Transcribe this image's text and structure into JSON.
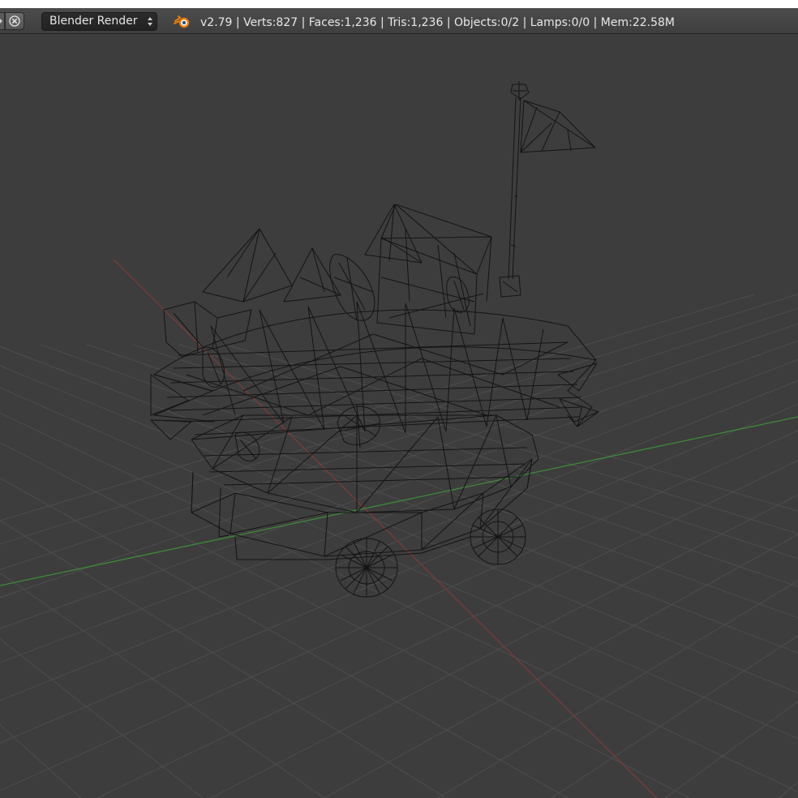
{
  "header": {
    "render_engine": "Blender Render",
    "stats": "v2.79 | Verts:827 | Faces:1,236 | Tris:1,236 | Objects:0/2 | Lamps:0/0 | Mem:22.58M"
  },
  "icons": {
    "close": "close-icon",
    "engine_arrows": "up-down-arrows-icon",
    "logo": "blender-logo-icon"
  },
  "colors": {
    "viewport_bg": "#3d3d3d",
    "grid": "#4a4a4a",
    "x_axis": "#8a3b3b",
    "y_axis": "#3f8a3a",
    "wire": "#111111"
  }
}
